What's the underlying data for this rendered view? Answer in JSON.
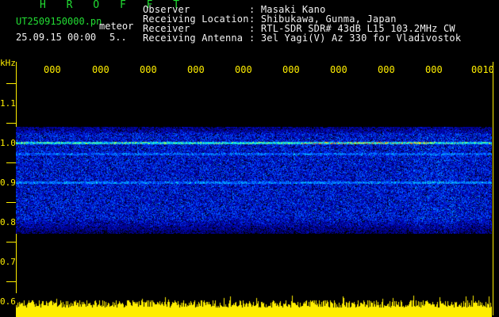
{
  "header": {
    "title": "H R O F F T",
    "filename": "UT2509150000.pn",
    "meteor_label": "meteor",
    "datetime": "25.09.15 00:00",
    "count": "5.."
  },
  "station": {
    "rows": [
      {
        "label": "Observer",
        "value": ": Masaki Kano"
      },
      {
        "label": "Receiving Location",
        "value": ": Shibukawa, Gunma, Japan"
      },
      {
        "label": "Receiver",
        "value": ": RTL-SDR SDR# 43dB L15 103.2MHz CW"
      },
      {
        "label": "Receiving Antenna",
        "value": ": 3el Yagi(V) Az 330 for Vladivostok"
      }
    ]
  },
  "axis": {
    "unit": "kHz",
    "y_ticks": [
      "1.1",
      "1.0",
      "0.9",
      "0.8",
      "0.7",
      "0.6"
    ],
    "x_ticks": [
      "000",
      "000",
      "000",
      "000",
      "000",
      "000",
      "000",
      "000",
      "000",
      "0010"
    ]
  },
  "colors": {
    "background": "#000000",
    "axis_yellow": "#ffee00",
    "title_green": "#22dd33",
    "text_white": "#f2f2f2"
  }
}
